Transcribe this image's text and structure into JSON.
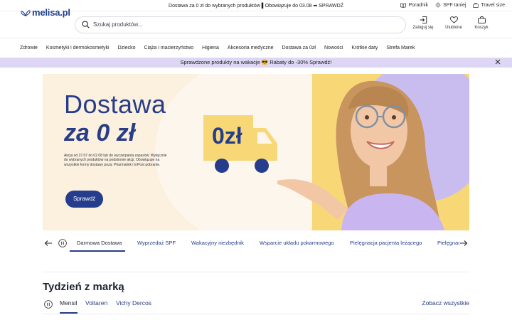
{
  "topbar": {
    "announcement": "Dostawa za 0 zł do wybranych produktów ▌Obowiązuje do 03.08 ➡ SPRAWDŹ",
    "links": [
      {
        "label": "Poradnik",
        "icon": "book-icon"
      },
      {
        "label": "SPF taniej",
        "icon": "sun-icon"
      },
      {
        "label": "Travel size",
        "icon": "suitcase-icon"
      }
    ]
  },
  "header": {
    "logo_text": "melisa.pl",
    "search_placeholder": "Szukaj produktów...",
    "actions": {
      "login": "Zaloguj się",
      "favorites": "Ulubione",
      "cart": "Koszyk"
    }
  },
  "nav": {
    "items": [
      "Zdrowie",
      "Kosmetyki i dermokosmetyki",
      "Dziecko",
      "Ciąża i macierzyństwo",
      "Higiena",
      "Akcesoria medyczne",
      "Dostawa za 0zł",
      "Nowości",
      "Krótkie daty",
      "Strefa Marek"
    ]
  },
  "promo": {
    "text": "Sprawdzone produkty na wakacje 😎 Rabaty do -30% Sprawdź!"
  },
  "hero": {
    "title_line1": "Dostawa",
    "title_line2": "za 0 zł",
    "fineprint": "Akcja od 27.07 do 02.08 lub do wyczerpania zapasów. Wyłącznie do wybranych produktów na podstronie akcji. Obowiązuje na wszystkie formy dostawy poza: Pharmalink i InPost pobranie.",
    "button_label": "Sprawdź",
    "truck_label": "0zł",
    "colors": {
      "bg": "#fcf1df",
      "accent": "#273d88",
      "yellow": "#f8d777",
      "lilac": "#c9bdf0"
    }
  },
  "carousel_tabs": {
    "items": [
      "Darmowa Dostawa",
      "Wyprzedaż SPF",
      "Wakacyjny niezbędnik",
      "Wsparcie układu pokarmowego",
      "Pielęgnacja pacjenta leżącego",
      "Pielęgnac"
    ],
    "active_index": 0
  },
  "brand_week": {
    "title": "Tydzień z marką",
    "tabs": [
      "Mensil",
      "Voltaren",
      "Vichy Dercos"
    ],
    "active_index": 0,
    "see_all": "Zobacz wszystkie"
  }
}
